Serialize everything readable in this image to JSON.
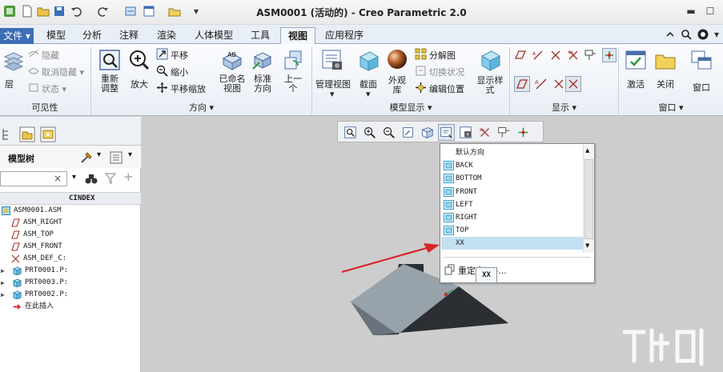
{
  "window": {
    "title": "ASM0001 (活动的) - Creo Parametric 2.0"
  },
  "ribbon": {
    "file_tab": "文件",
    "tabs": [
      "模型",
      "分析",
      "注释",
      "渲染",
      "人体模型",
      "工具",
      "视图",
      "应用程序"
    ],
    "active_tab": "视图",
    "groups": {
      "visibility": {
        "label": "可见性",
        "layer": "层",
        "hide": "隐藏",
        "unhide": "取消隐藏",
        "status": "状态"
      },
      "orientation": {
        "label": "方向",
        "refit": "重新调整",
        "zoom_in": "放大",
        "pan": "平移",
        "zoom_out": "缩小",
        "pan_zoom": "平移缩放",
        "named_views": "已命名视图",
        "standard_orientation": "标准方向",
        "previous": "上一个"
      },
      "model_display": {
        "label": "模型显示",
        "manage_views": "管理视图",
        "section": "截面",
        "appearance": "外观库",
        "exploded_view": "分解图",
        "toggle_status": "切换状况",
        "edit_position": "编辑位置",
        "display_style": "显示样式"
      },
      "show": {
        "label": "显示"
      },
      "window": {
        "label": "窗口",
        "activate": "激活",
        "close": "关闭",
        "windows": "窗口"
      }
    }
  },
  "model_tree": {
    "title": "模型树",
    "column_header": "CINDEX",
    "items": [
      {
        "label": "ASM0001.ASM",
        "icon": "assembly-icon"
      },
      {
        "label": "ASM_RIGHT",
        "icon": "datum-plane-icon"
      },
      {
        "label": "ASM_TOP",
        "icon": "datum-plane-icon"
      },
      {
        "label": "ASM_FRONT",
        "icon": "datum-plane-icon"
      },
      {
        "label": "ASM_DEF_C:",
        "icon": "csys-icon"
      },
      {
        "label": "PRT0001.P:",
        "icon": "part-icon"
      },
      {
        "label": "PRT0003.P:",
        "icon": "part-icon"
      },
      {
        "label": "PRT0002.P:",
        "icon": "part-icon"
      },
      {
        "label": "在此插入",
        "icon": "insert-here-icon"
      }
    ]
  },
  "saved_orientations": {
    "items": [
      {
        "label": "默认方向",
        "icon": ""
      },
      {
        "label": "BACK",
        "icon": "view-icon"
      },
      {
        "label": "BOTTOM",
        "icon": "view-icon"
      },
      {
        "label": "FRONT",
        "icon": "view-icon"
      },
      {
        "label": "LEFT",
        "icon": "view-icon"
      },
      {
        "label": "RIGHT",
        "icon": "view-icon"
      },
      {
        "label": "TOP",
        "icon": "view-icon"
      },
      {
        "label": "XX",
        "icon": ""
      }
    ],
    "selected": "XX",
    "reorient": "重定向(O)...",
    "tooltip": "XX"
  },
  "colors": {
    "accent": "#c3e0f3",
    "arrow": "#d8262b",
    "model_top": "#97a2ab",
    "model_side": "#5f6870",
    "model_bottom": "#2b2f33"
  }
}
